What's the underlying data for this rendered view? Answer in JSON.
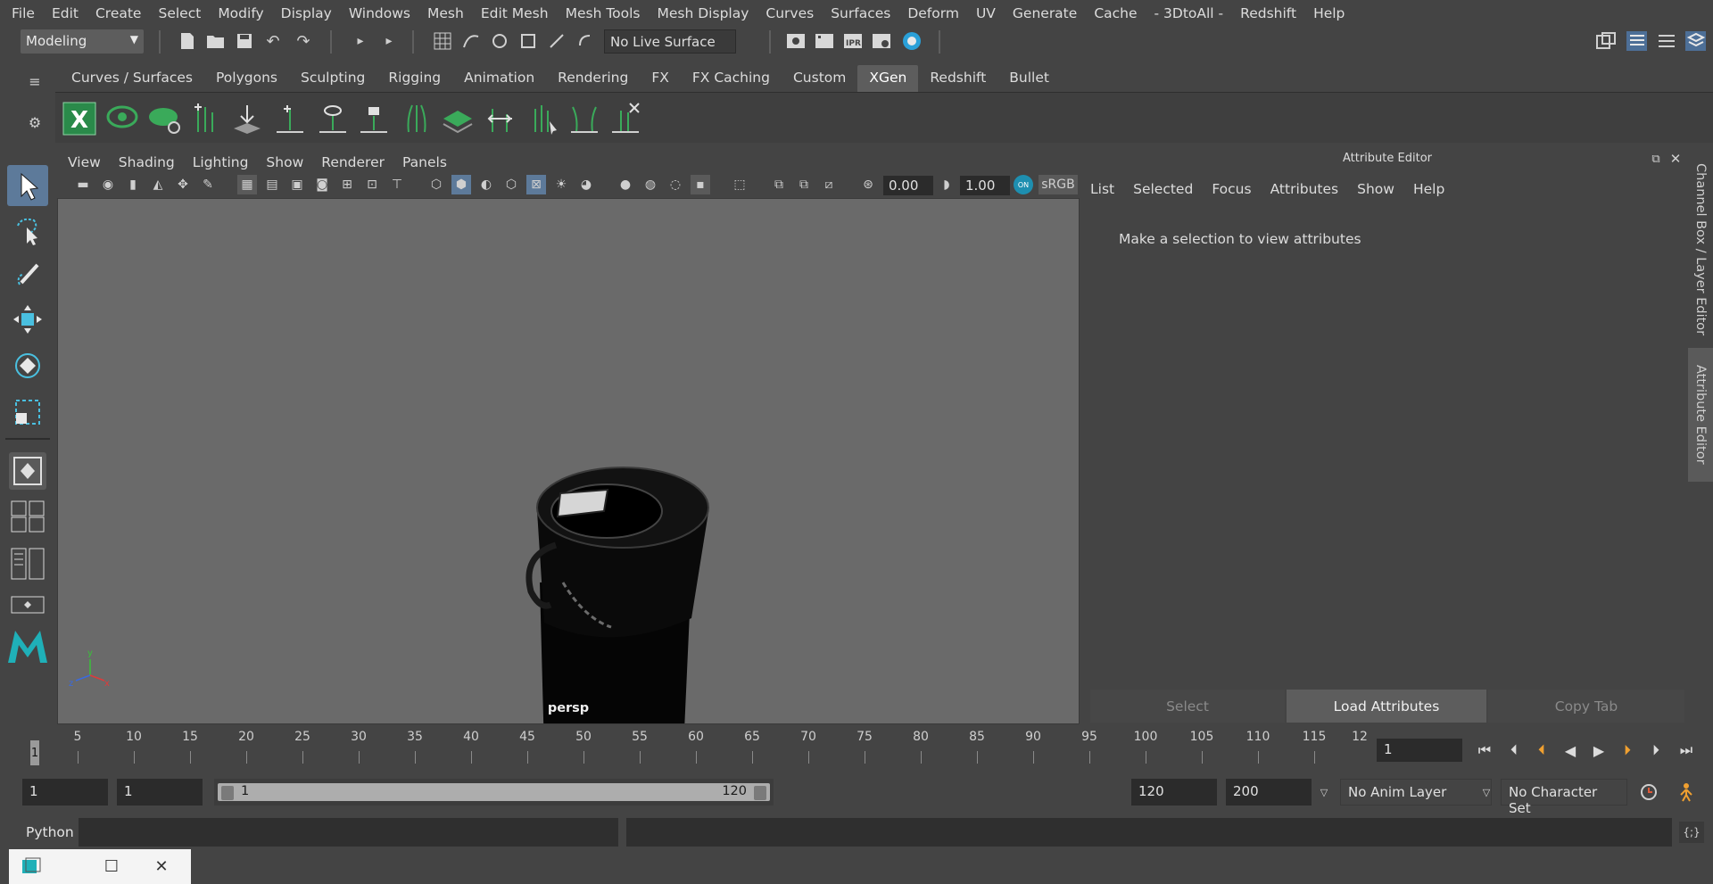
{
  "menubar": {
    "items": [
      "File",
      "Edit",
      "Create",
      "Select",
      "Modify",
      "Display",
      "Windows",
      "Mesh",
      "Edit Mesh",
      "Mesh Tools",
      "Mesh Display",
      "Curves",
      "Surfaces",
      "Deform",
      "UV",
      "Generate",
      "Cache",
      "- 3DtoAll -",
      "Redshift",
      "Help"
    ]
  },
  "statusline": {
    "mode": "Modeling",
    "live_surface": "No Live Surface"
  },
  "shelf": {
    "tabs": [
      "Curves / Surfaces",
      "Polygons",
      "Sculpting",
      "Rigging",
      "Animation",
      "Rendering",
      "FX",
      "FX Caching",
      "Custom",
      "XGen",
      "Redshift",
      "Bullet"
    ],
    "active_tab": "XGen"
  },
  "viewport": {
    "menu": [
      "View",
      "Shading",
      "Lighting",
      "Show",
      "Renderer",
      "Panels"
    ],
    "exposure": "0.00",
    "gamma": "1.00",
    "color_space": "sRGB",
    "camera_label": "persp"
  },
  "attribute_editor": {
    "title": "Attribute Editor",
    "menu": [
      "List",
      "Selected",
      "Focus",
      "Attributes",
      "Show",
      "Help"
    ],
    "message": "Make a selection to view attributes",
    "buttons": {
      "select": "Select",
      "load": "Load Attributes",
      "copy": "Copy Tab"
    }
  },
  "side_tabs": {
    "channel_box": "Channel Box / Layer Editor",
    "attribute_editor": "Attribute Editor"
  },
  "timeline": {
    "labels": [
      "5",
      "10",
      "15",
      "20",
      "25",
      "30",
      "35",
      "40",
      "45",
      "50",
      "55",
      "60",
      "65",
      "70",
      "75",
      "80",
      "85",
      "90",
      "95",
      "100",
      "105",
      "110",
      "115",
      "12"
    ],
    "current_frame_marker": "1",
    "current_frame": "1"
  },
  "range": {
    "start": "1",
    "playback_start": "1",
    "slider_start": "1",
    "slider_end": "120",
    "playback_end": "120",
    "end": "200",
    "anim_layer": "No Anim Layer",
    "character_set": "No Character Set"
  },
  "command_line": {
    "language": "Python"
  },
  "colors": {
    "active_tool": "#5d7a9a",
    "xgen_green": "#3aaa5a",
    "viewport_bg": "#6a6a6a",
    "panel_bg": "#444444"
  }
}
